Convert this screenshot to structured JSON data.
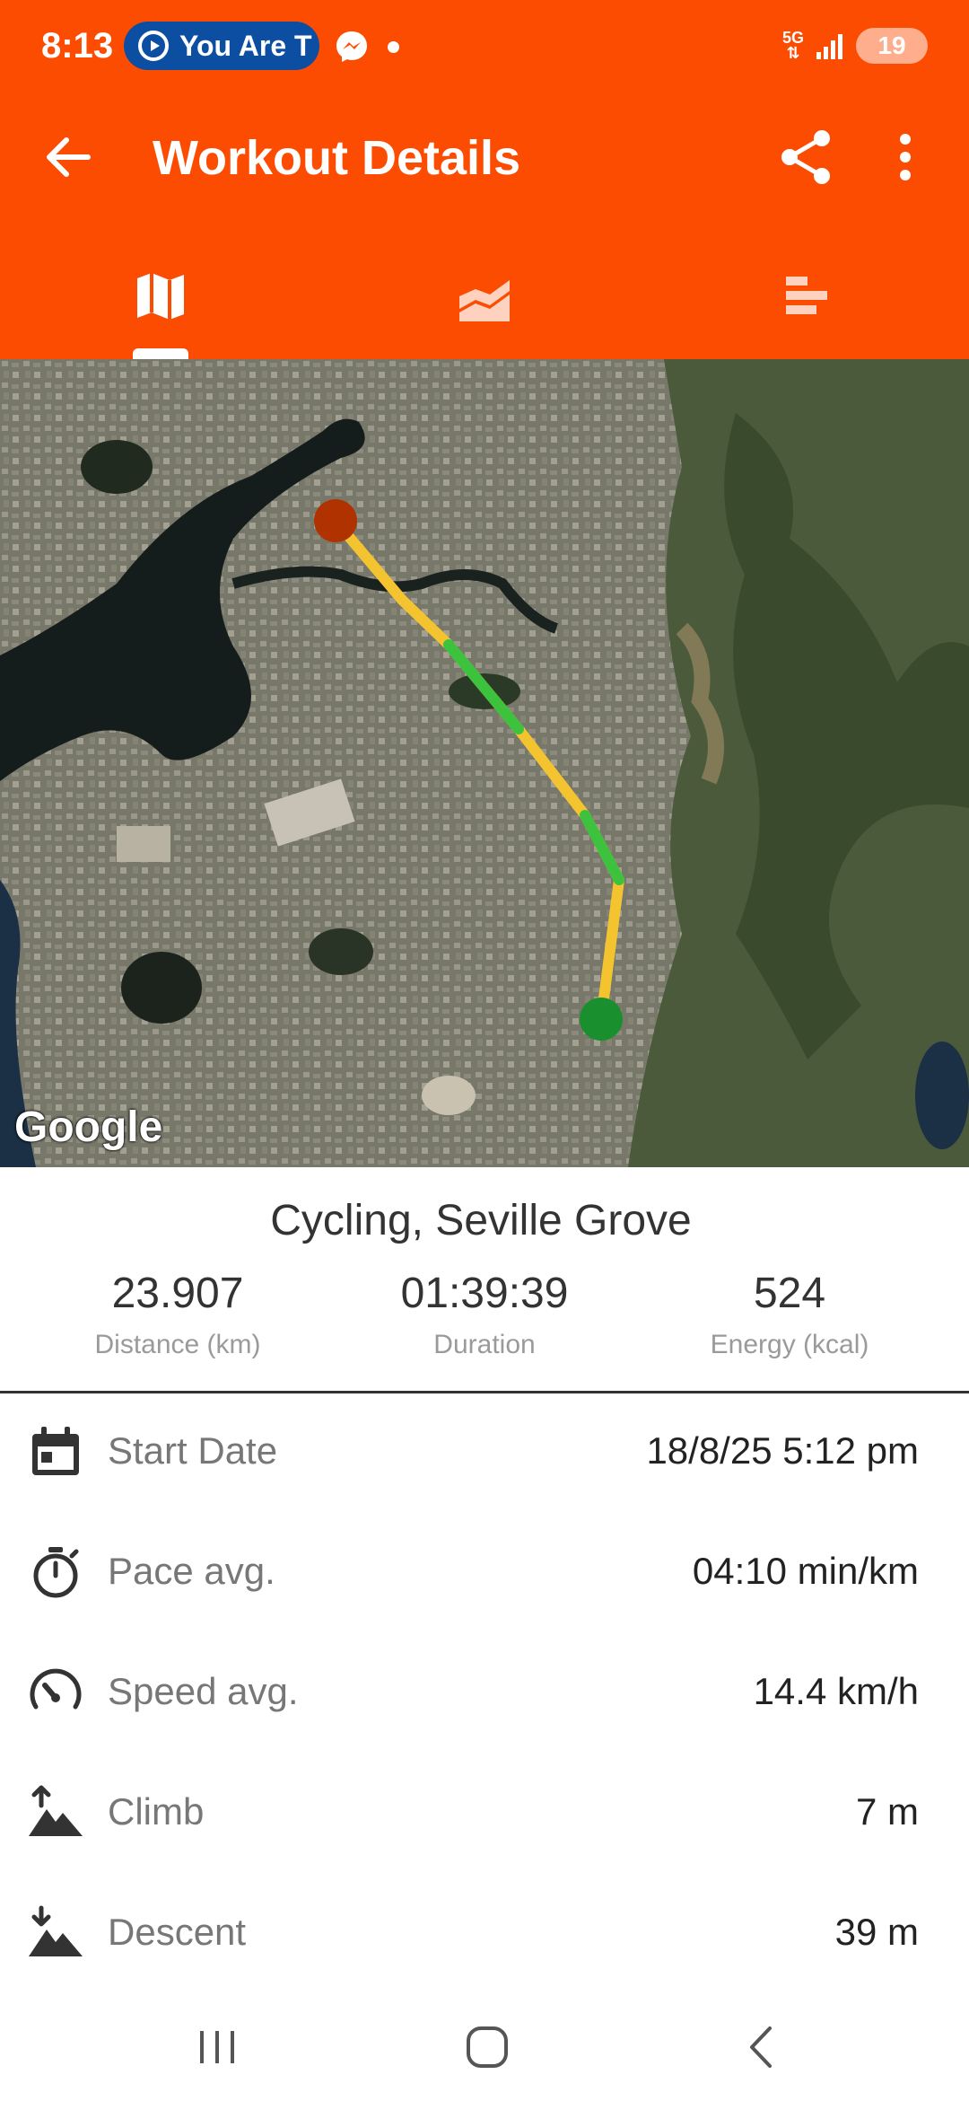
{
  "status_bar": {
    "time": "8:13",
    "media_pill_text": "You Are T",
    "network_type": "5G",
    "battery": "19",
    "icons": [
      "media-play-icon",
      "messenger-icon",
      "notification-dot",
      "5g-icon",
      "signal-icon",
      "battery-icon"
    ]
  },
  "toolbar": {
    "title": "Workout Details",
    "back_icon": "arrow-back-icon",
    "share_icon": "share-icon",
    "more_icon": "more-vertical-icon"
  },
  "tabs": [
    {
      "icon": "map-icon",
      "selected": true
    },
    {
      "icon": "area-chart-icon",
      "selected": false
    },
    {
      "icon": "bar-list-icon",
      "selected": false
    }
  ],
  "map": {
    "attribution": "Google",
    "route_colors": [
      "#f4c430",
      "#3cc23c"
    ],
    "start_marker_color": "#1a8f2e",
    "end_marker_color": "#b03200"
  },
  "summary": {
    "title": "Cycling, Seville Grove",
    "stats": [
      {
        "value": "23.907",
        "label": "Distance (km)"
      },
      {
        "value": "01:39:39",
        "label": "Duration"
      },
      {
        "value": "524",
        "label": "Energy (kcal)"
      }
    ]
  },
  "details": [
    {
      "icon": "calendar-icon",
      "label": "Start Date",
      "value": "18/8/25 5:12 pm"
    },
    {
      "icon": "stopwatch-icon",
      "label": "Pace avg.",
      "value": "04:10 min/km"
    },
    {
      "icon": "speedometer-icon",
      "label": "Speed avg.",
      "value": "14.4 km/h"
    },
    {
      "icon": "climb-icon",
      "label": "Climb",
      "value": "7 m"
    },
    {
      "icon": "descent-icon",
      "label": "Descent",
      "value": "39 m"
    }
  ],
  "navbar": {
    "icons": [
      "recent-apps-icon",
      "home-icon",
      "back-icon"
    ]
  },
  "colors": {
    "accent": "#fc4c02",
    "text_primary": "#222222",
    "text_secondary": "#777777"
  }
}
